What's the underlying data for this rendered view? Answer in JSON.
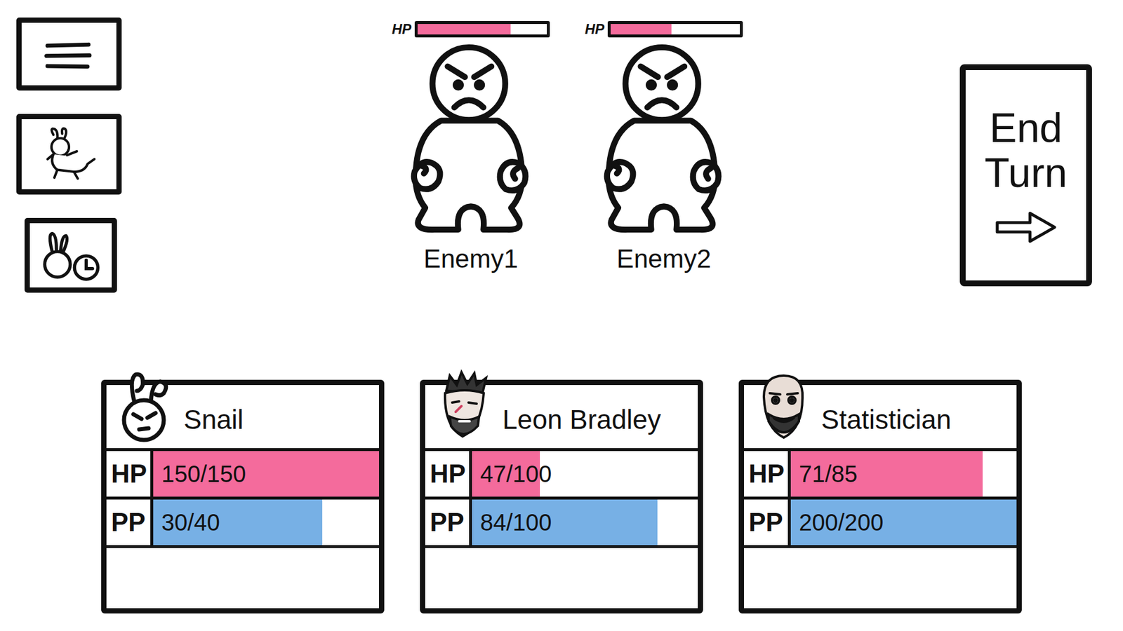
{
  "enemies": [
    {
      "name": "Enemy1",
      "hp_label": "HP",
      "hp_level": 0.72
    },
    {
      "name": "Enemy2",
      "hp_label": "HP",
      "hp_level": 0.47
    }
  ],
  "end_turn": {
    "label": "End Turn"
  },
  "party": [
    {
      "name": "Snail",
      "kind": "snail",
      "hp_label": "HP",
      "hp": "150/150",
      "hp_level": 1,
      "pp_label": "PP",
      "pp": "30/40",
      "pp_level": 0.75
    },
    {
      "name": "Leon Bradley",
      "kind": "fighter",
      "hp_label": "HP",
      "hp": "47/100",
      "hp_level": 0.3,
      "pp_label": "PP",
      "pp": "84/100",
      "pp_level": 0.82
    },
    {
      "name": "Statistician",
      "kind": "grinner",
      "hp_label": "HP",
      "hp": "71/85",
      "hp_level": 0.85,
      "pp_label": "PP",
      "pp": "200/200",
      "pp_level": 1
    }
  ]
}
